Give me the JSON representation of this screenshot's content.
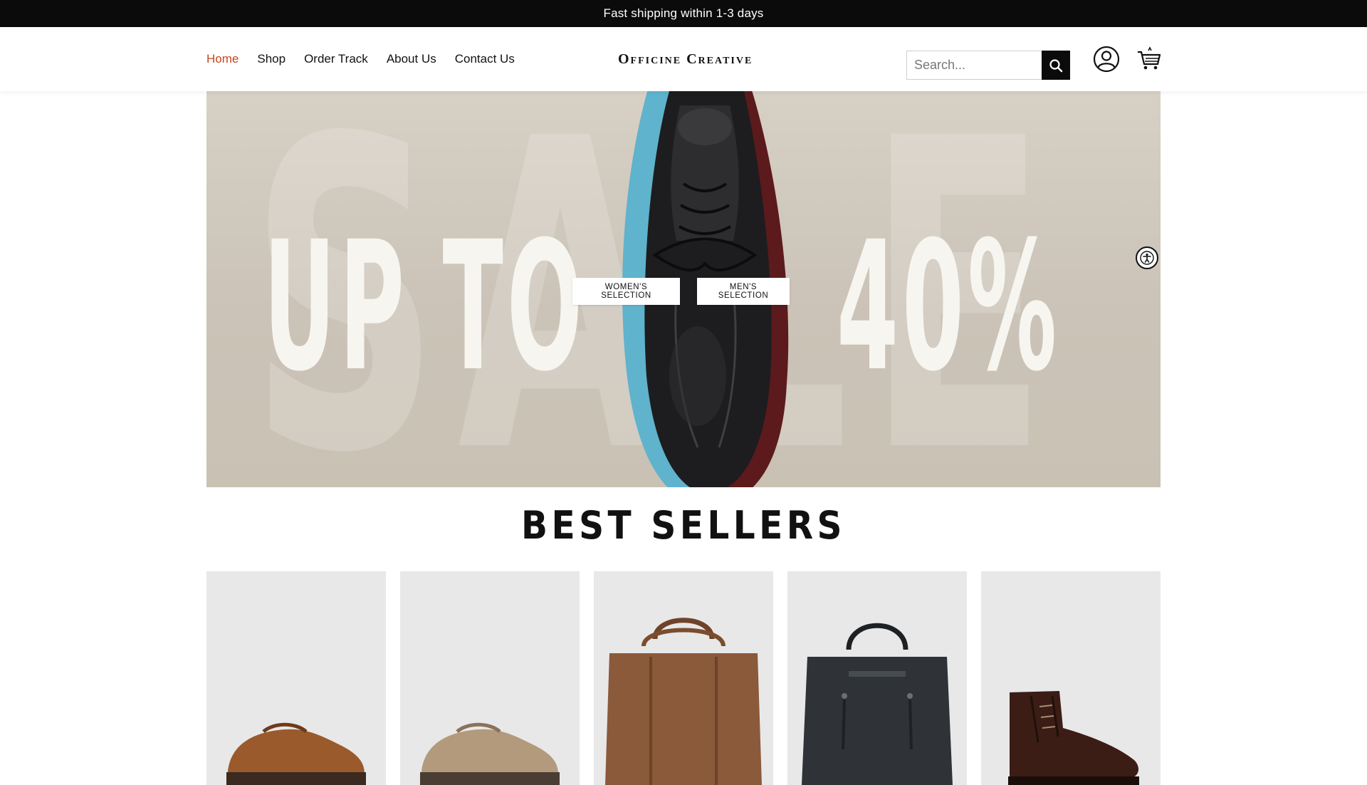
{
  "announcement": {
    "text": "Fast shipping within 1-3 days"
  },
  "nav": {
    "items": [
      {
        "label": "Home",
        "active": true
      },
      {
        "label": "Shop",
        "active": false
      },
      {
        "label": "Order Track",
        "active": false
      },
      {
        "label": "About Us",
        "active": false
      },
      {
        "label": "Contact Us",
        "active": false
      }
    ]
  },
  "brand": {
    "name": "Officine Creative"
  },
  "search": {
    "placeholder": "Search..."
  },
  "icons": {
    "search": "search-icon",
    "user": "user-icon",
    "cart": "cart-icon",
    "accessibility": "accessibility-icon"
  },
  "hero": {
    "watermark": "SALE",
    "left_text": "UP TO",
    "right_text": "40%",
    "buttons": {
      "women": "WOMEN'S SELECTION",
      "men": "MEN'S SELECTION"
    }
  },
  "best_sellers": {
    "title": "BEST SELLERS",
    "products": [
      {
        "type": "loafer",
        "color": "#9a5a2c"
      },
      {
        "type": "loafer",
        "color": "#b39a7c"
      },
      {
        "type": "tote-bag",
        "color": "#8b5a3a"
      },
      {
        "type": "tote-bag",
        "color": "#2f3337"
      },
      {
        "type": "boot",
        "color": "#3b1d16"
      }
    ]
  },
  "colors": {
    "accent": "#c8461c",
    "dark": "#0b0b0b",
    "hero_bg": "#d1c9bd"
  }
}
